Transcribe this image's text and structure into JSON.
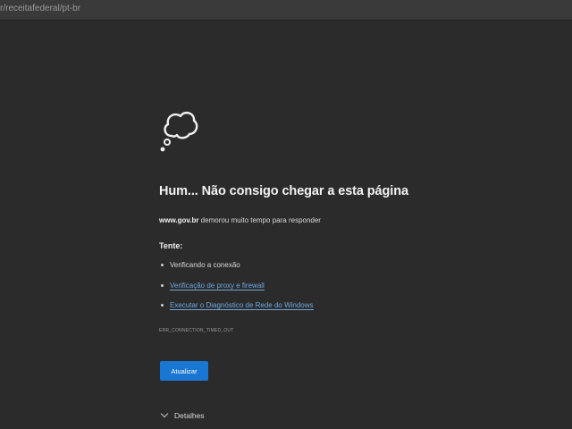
{
  "address_bar": {
    "url": "r/receitafederal/pt-br"
  },
  "error_page": {
    "icon": "thought-cloud-icon",
    "title": "Hum... Não consigo chegar a esta página",
    "host": "www.gov.br",
    "message": " demorou muito tempo para responder",
    "try_label": "Tente:",
    "suggestions": [
      "Verificando a conexão",
      "Verificação de proxy e firewall",
      "Executar o Diagnóstico de Rede do Windows"
    ],
    "error_code": "ERR_CONNECTION_TIMED_OUT",
    "refresh_button": "Atualizar",
    "details_label": "Detalhes"
  },
  "colors": {
    "background": "#2b2b2b",
    "link": "#6fa8dc",
    "button": "#1976d2"
  }
}
